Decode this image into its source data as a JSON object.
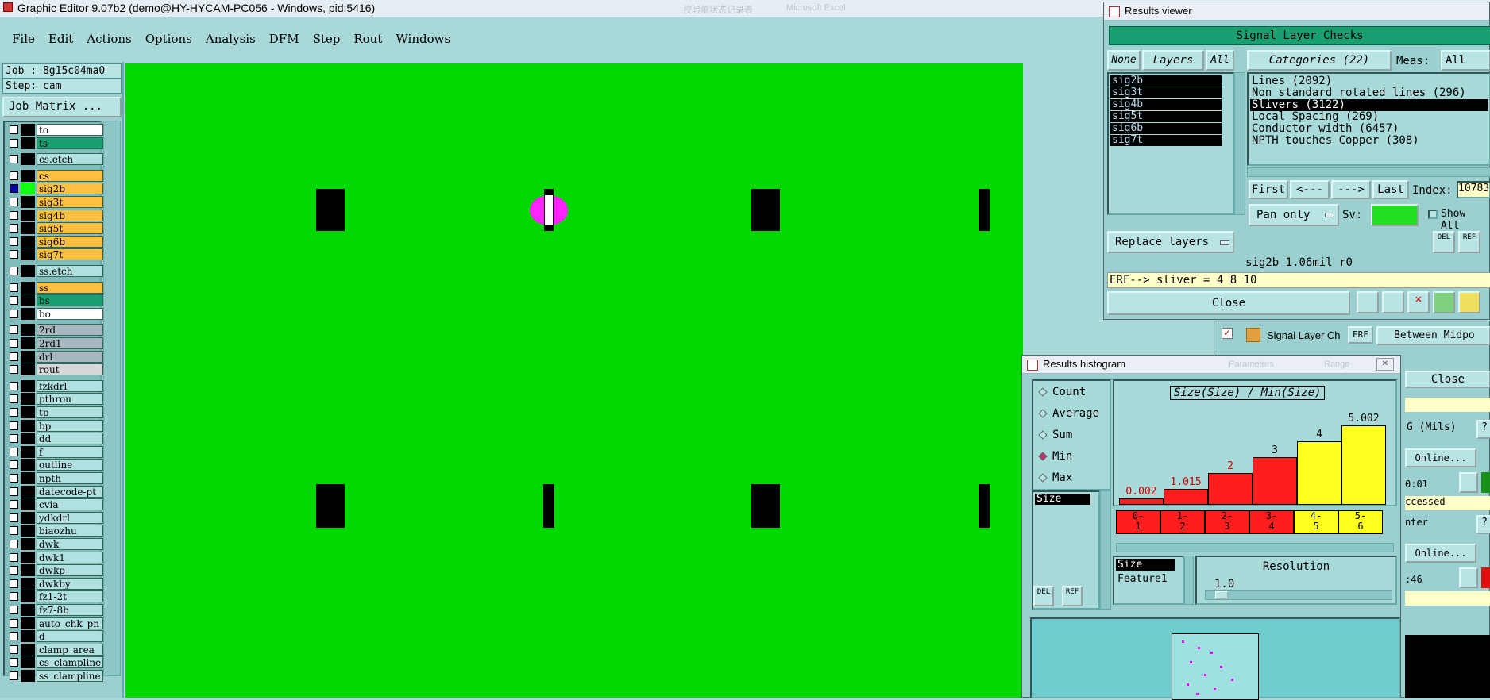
{
  "app": {
    "title": "Graphic Editor 9.07b2 (demo@HY-HYCAM-PC056 - Windows, pid:5416)",
    "bg_title_1": "校验单状态记录表",
    "bg_title_2": "Microsoft Excel"
  },
  "menu": [
    "File",
    "Edit",
    "Actions",
    "Options",
    "Analysis",
    "DFM",
    "Step",
    "Rout",
    "Windows"
  ],
  "job": {
    "job_label": "Job : 8g15c04ma0",
    "step_label": "Step: cam",
    "matrix_button": "Job Matrix ..."
  },
  "layers": [
    {
      "name": "to",
      "color": "#ffffff"
    },
    {
      "name": "ts",
      "color": "#1aa070"
    },
    {
      "name": "cs.etch",
      "color": "#b0e0e0"
    },
    {
      "name": "cs",
      "color": "#ffc040"
    },
    {
      "name": "sig2b",
      "color": "#ffc040"
    },
    {
      "name": "sig3t",
      "color": "#ffc040"
    },
    {
      "name": "sig4b",
      "color": "#ffc040"
    },
    {
      "name": "sig5t",
      "color": "#ffc040"
    },
    {
      "name": "sig6b",
      "color": "#ffc040"
    },
    {
      "name": "sig7t",
      "color": "#ffc040"
    },
    {
      "name": "ss.etch",
      "color": "#b0e0e0"
    },
    {
      "name": "ss",
      "color": "#ffc040"
    },
    {
      "name": "bs",
      "color": "#1aa070"
    },
    {
      "name": "bo",
      "color": "#ffffff"
    },
    {
      "name": "2rd",
      "color": "#a8b8c0"
    },
    {
      "name": "2rd1",
      "color": "#a8b8c0"
    },
    {
      "name": "drl",
      "color": "#a8b8c0"
    },
    {
      "name": "rout",
      "color": "#d8d8d8"
    },
    {
      "name": "fzkdrl",
      "color": "#b0e0e0"
    },
    {
      "name": "pthrou",
      "color": "#b0e0e0"
    },
    {
      "name": "tp",
      "color": "#b0e0e0"
    },
    {
      "name": "bp",
      "color": "#b0e0e0"
    },
    {
      "name": "dd",
      "color": "#b0e0e0"
    },
    {
      "name": "f",
      "color": "#b0e0e0"
    },
    {
      "name": "outline",
      "color": "#b0e0e0"
    },
    {
      "name": "npth",
      "color": "#b0e0e0"
    },
    {
      "name": "datecode-pt",
      "color": "#b0e0e0"
    },
    {
      "name": "cvia",
      "color": "#b0e0e0"
    },
    {
      "name": "ydkdrl",
      "color": "#b0e0e0"
    },
    {
      "name": "biaozhu",
      "color": "#b0e0e0"
    },
    {
      "name": "dwk",
      "color": "#b0e0e0"
    },
    {
      "name": "dwk1",
      "color": "#b0e0e0"
    },
    {
      "name": "dwkp",
      "color": "#b0e0e0"
    },
    {
      "name": "dwkby",
      "color": "#b0e0e0"
    },
    {
      "name": "fz1-2t",
      "color": "#b0e0e0"
    },
    {
      "name": "fz7-8b",
      "color": "#b0e0e0"
    },
    {
      "name": "auto_chk_pn",
      "color": "#b0e0e0"
    },
    {
      "name": "d",
      "color": "#b0e0e0"
    },
    {
      "name": "clamp_area",
      "color": "#b0e0e0"
    },
    {
      "name": "cs_clampline",
      "color": "#b0e0e0"
    },
    {
      "name": "ss_clampline",
      "color": "#b0e0e0"
    }
  ],
  "results_viewer": {
    "title": "Results viewer",
    "header": "Signal Layer Checks",
    "none_btn": "None",
    "layers_btn": "Layers",
    "all_btn": "All",
    "categories_btn": "Categories (22)",
    "meas_label": "Meas:",
    "meas_value": "All",
    "layer_items": [
      "sig2b",
      "sig3t",
      "sig4b",
      "sig5t",
      "sig6b",
      "sig7t"
    ],
    "category_items": [
      "Lines (2092)",
      "Non standard rotated lines (296)",
      "Slivers (3122)",
      "Local Spacing (269)",
      "Conductor width (6457)",
      "NPTH touches Copper (308)"
    ],
    "first_btn": "First",
    "prev_btn": "<---",
    "next_btn": "--->",
    "last_btn": "Last",
    "index_label": "Index:",
    "index_value": "10783",
    "pan_option": "Pan only",
    "sv_label": "Sv:",
    "show_all_label": "Show All",
    "replace_layers": "Replace layers",
    "del_label": "DEL",
    "ref_label": "REF",
    "status_line": "sig2b 1.06mil  r0",
    "erf_line": "ERF--> sliver = 4 8 10",
    "close_btn": "Close"
  },
  "histogram": {
    "title": "Results histogram",
    "bg_tab1": "Parameters",
    "bg_tab2": "Range",
    "options": [
      "Count",
      "Average",
      "Sum",
      "Min",
      "Max"
    ],
    "selected_option": "Min",
    "chart_title": "Size(Size) / Min(Size)",
    "bins": [
      "0-1",
      "1-2",
      "2-3",
      "3-4",
      "4-5",
      "5-6"
    ],
    "bin_top": [
      "0-",
      "1-",
      "2-",
      "3-",
      "4-",
      "5-"
    ],
    "bin_bottom": [
      "1",
      "2",
      "3",
      "4",
      "5",
      "6"
    ],
    "values": [
      0.002,
      1.015,
      2,
      3,
      4,
      5.002
    ],
    "value_labels": [
      "0.002",
      "1.015",
      "2",
      "3",
      "4",
      "5.002"
    ],
    "bar_colors": [
      "#ff1e1e",
      "#ff1e1e",
      "#ff1e1e",
      "#ff1e1e",
      "#ffff1e",
      "#ffff1e"
    ],
    "label_colors": [
      "#cc0000",
      "#cc0000",
      "#cc0000",
      "#000000",
      "#000000",
      "#000000"
    ],
    "attr_list": [
      "Size"
    ],
    "param_list": [
      "Size",
      "Feature1"
    ],
    "resolution_label": "Resolution",
    "resolution_value": "1.0",
    "del_label": "DEL",
    "ref_label": "REF"
  },
  "bg_window": {
    "erf_tag": "ERF",
    "signal_layer": "Signal Layer Ch",
    "between_midpoint": "Between Midpo",
    "close": "Close",
    "g_mils": "G (Mils)",
    "online1": "Online...",
    "time1": "0:01",
    "accessed": "ccessed",
    "nter": "nter",
    "online2": "Online...",
    "time2": ":46",
    "q_mark": "?"
  }
}
